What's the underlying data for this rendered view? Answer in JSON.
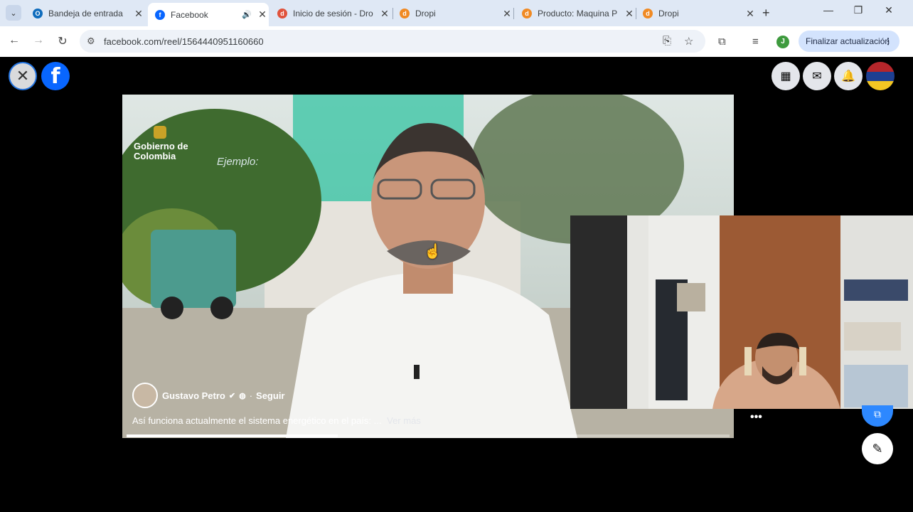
{
  "browser": {
    "tabs": [
      {
        "title": "Bandeja de entrada",
        "favicon": "outlook-icon",
        "color": "#0f6cbd",
        "active": false
      },
      {
        "title": "Facebook",
        "favicon": "facebook-icon",
        "color": "#0866ff",
        "active": true,
        "audio": "speaker-icon"
      },
      {
        "title": "Inicio de sesión - Dro",
        "favicon": "dropi-icon",
        "color": "#e0533c",
        "active": false
      },
      {
        "title": "Dropi",
        "favicon": "dropi-icon",
        "color": "#f08a24",
        "active": false
      },
      {
        "title": "Producto: Maquina P",
        "favicon": "dropi-icon",
        "color": "#f08a24",
        "active": false
      },
      {
        "title": "Dropi",
        "favicon": "dropi-icon",
        "color": "#f08a24",
        "active": false
      }
    ],
    "url": "facebook.com/reel/1564440951160660",
    "profile_initial": "J",
    "update_label": "Finalizar actualización"
  },
  "reel": {
    "overlay_brand": "Gobierno de Colombia",
    "overlay_example": "Ejemplo:",
    "author_name": "Gustavo Petro",
    "follow_label": "Seguir",
    "caption": "Así funciona actualmente el sistema energético en el país: ...",
    "see_more": "Ver más",
    "progress": 0.35
  },
  "colors": {
    "accent": "#0866ff",
    "tab_strip": "#dfe8f5"
  }
}
